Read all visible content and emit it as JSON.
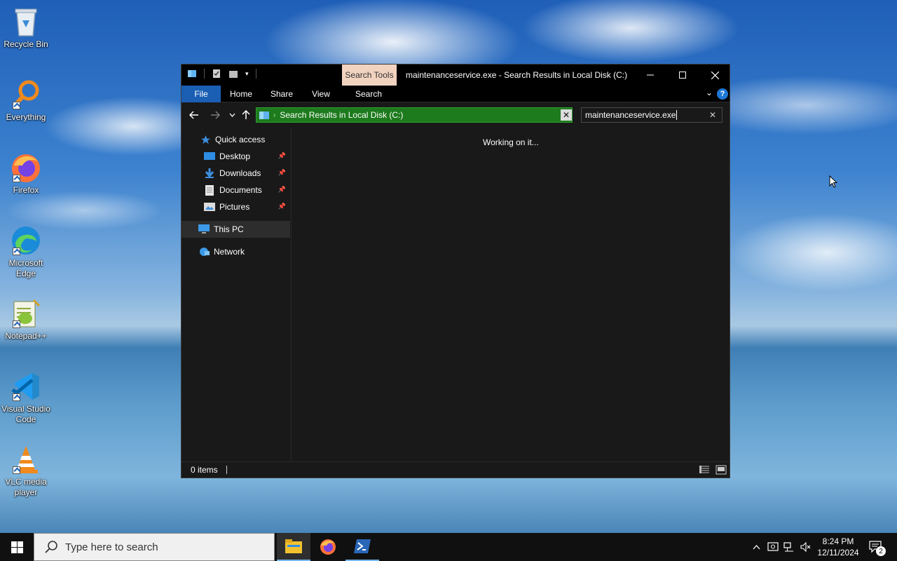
{
  "desktop": {
    "icons": [
      {
        "name": "recycle-bin",
        "label": "Recycle Bin"
      },
      {
        "name": "everything",
        "label": "Everything"
      },
      {
        "name": "firefox",
        "label": "Firefox"
      },
      {
        "name": "edge",
        "label": "Microsoft Edge"
      },
      {
        "name": "notepadpp",
        "label": "Notepad++"
      },
      {
        "name": "vscode",
        "label": "Visual Studio Code"
      },
      {
        "name": "vlc",
        "label": "VLC media player"
      }
    ]
  },
  "window": {
    "contextual_tab": "Search Tools",
    "title": "maintenanceservice.exe - Search Results in Local Disk (C:)",
    "ribbon_tabs": [
      "File",
      "Home",
      "Share",
      "View",
      "Search"
    ],
    "help": "?",
    "address_path": "Search Results in Local Disk (C:)",
    "search_value": "maintenanceservice.exe",
    "nav": {
      "quick_access": "Quick access",
      "desktop": "Desktop",
      "downloads": "Downloads",
      "documents": "Documents",
      "pictures": "Pictures",
      "this_pc": "This PC",
      "network": "Network"
    },
    "content_message": "Working on it...",
    "status_count": "0 items"
  },
  "taskbar": {
    "search_placeholder": "Type here to search",
    "time": "8:24 PM",
    "date": "12/11/2024",
    "notification_count": "2"
  },
  "colors": {
    "accent": "#1a5fb4",
    "address_bg": "#1d7a1d",
    "contextual_tab_bg": "#f1d3c0"
  }
}
